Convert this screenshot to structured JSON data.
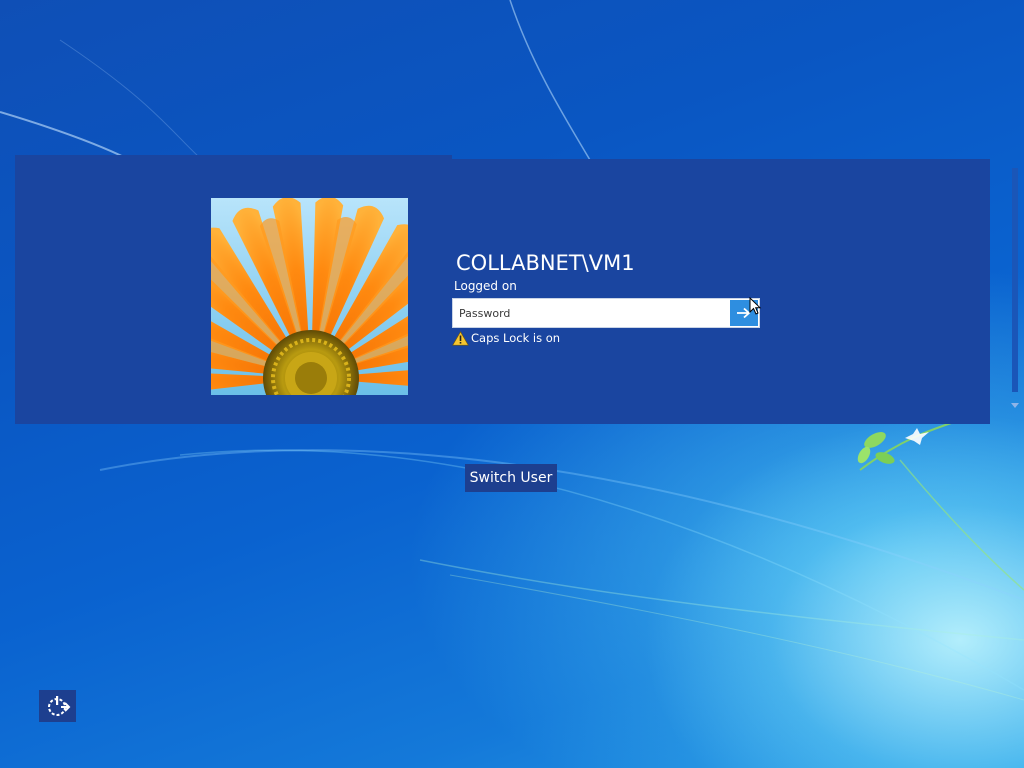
{
  "account": {
    "username": "COLLABNET\\VM1",
    "status": "Logged on"
  },
  "password": {
    "placeholder": "Password",
    "value": "",
    "submit_icon": "arrow-right-icon"
  },
  "warning": {
    "icon": "warning-icon",
    "text": "Caps Lock is on"
  },
  "actions": {
    "switch_user_label": "Switch User",
    "ease_of_access_icon": "ease-of-access-icon"
  },
  "colors": {
    "panel": "#1a45a0",
    "button": "#1d3f8f",
    "submit": "#2e8ee0",
    "background": "#0a56c2"
  }
}
